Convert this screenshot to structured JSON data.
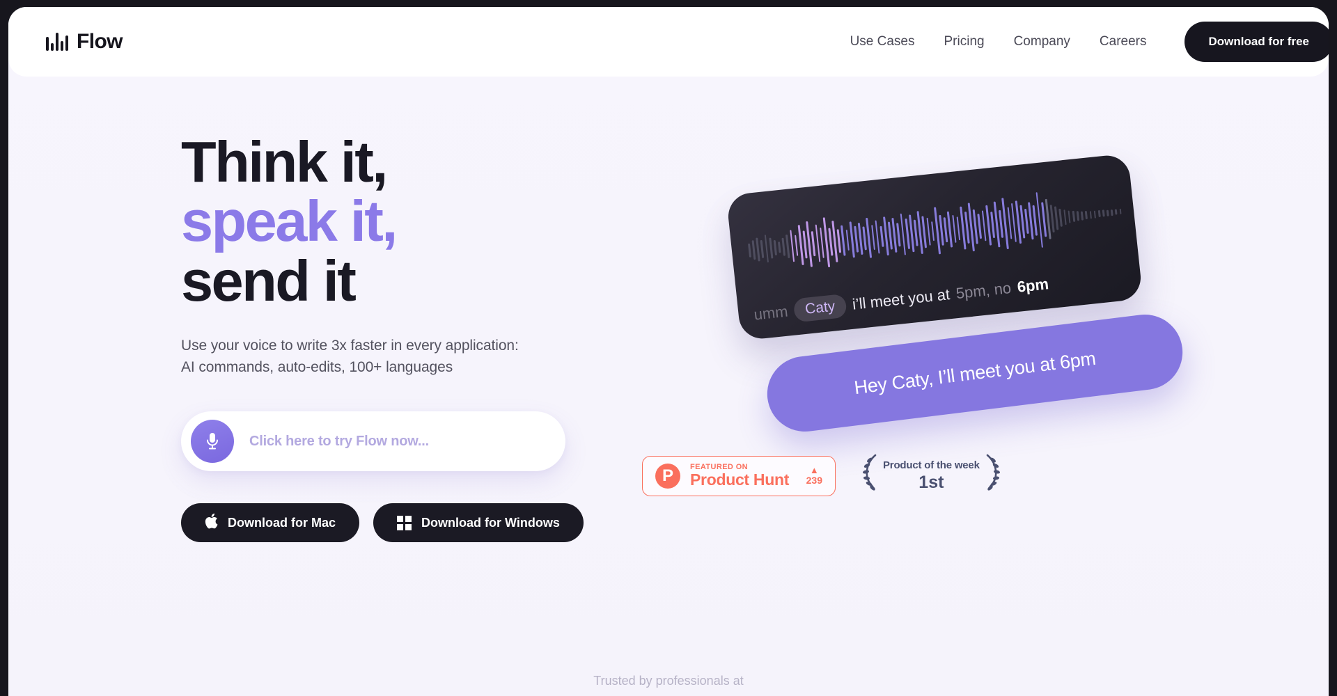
{
  "brand": {
    "name": "Flow",
    "logo_icon": "waveform-icon"
  },
  "nav": {
    "items": [
      {
        "label": "Use Cases"
      },
      {
        "label": "Pricing"
      },
      {
        "label": "Company"
      },
      {
        "label": "Careers"
      }
    ],
    "cta_label": "Download for free"
  },
  "hero": {
    "headline_line1": "Think it,",
    "headline_line2": "speak it,",
    "headline_line3": "send it",
    "subhead_line1": "Use your voice to write 3x faster in every application:",
    "subhead_line2": "AI commands, auto-edits, 100+ languages",
    "try_placeholder": "Click here to try Flow now...",
    "mic_icon": "microphone-icon",
    "download_mac": "Download for Mac",
    "download_windows": "Download for Windows",
    "apple_icon": "apple-icon",
    "windows_icon": "windows-icon"
  },
  "demo": {
    "caption_pre": "umm",
    "caption_chip": "Caty",
    "caption_main": "i’ll meet you at",
    "caption_strike": "5pm, no",
    "caption_strong": "6pm",
    "reply": "Hey Caty, I’ll meet you at 6pm"
  },
  "badges": {
    "product_hunt": {
      "featured_label": "FEATURED ON",
      "name": "Product Hunt",
      "upvote_icon": "upvote-triangle-icon",
      "votes": "239",
      "logo_letter": "P"
    },
    "award": {
      "title": "Product of the week",
      "rank": "1st",
      "laurel_icon": "laurel-wreath-icon"
    }
  },
  "footer": {
    "trusted_label": "Trusted by professionals at"
  },
  "colors": {
    "accent_purple": "#8b7ae8",
    "bubble_purple": "#8577e0",
    "dark": "#17161f",
    "product_hunt": "#fa6f5d",
    "page_bg": "#f7f5fd"
  }
}
